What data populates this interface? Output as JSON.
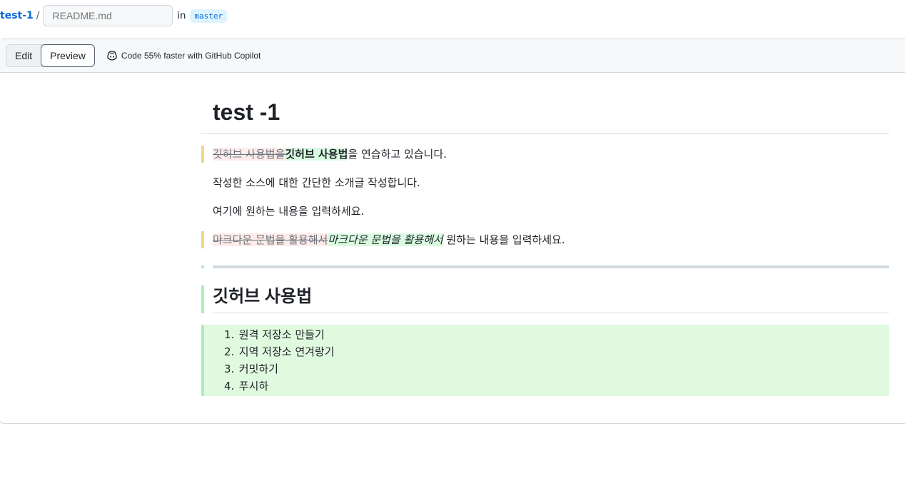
{
  "path": {
    "repo": "test-1",
    "separator": "/",
    "filename_placeholder": "README.md",
    "in_label": "in",
    "branch": "master"
  },
  "editor": {
    "tabs": {
      "edit": "Edit",
      "preview": "Preview"
    },
    "copilot_text": "Code 55% faster with GitHub Copilot"
  },
  "preview": {
    "h1": "test -1",
    "line1": {
      "deleted": "깃허브 사용법을",
      "inserted": "깃허브 사용법",
      "rest": "을 연습하고 있습니다."
    },
    "line2": "작성한 소스에 대한 간단한 소개글 작성합니다.",
    "line3": "여기에 원하는 내용을 입력하세요.",
    "line4": {
      "deleted": "마크다운 문법을 활용해서",
      "inserted": "마크다운 문법을 활용해서",
      "rest": " 원하는 내용을 입력하세요."
    },
    "h2": "깃허브 사용법",
    "list": [
      {
        "num": "1.",
        "text": "원격 저장소 만들기"
      },
      {
        "num": "2.",
        "text": "지역 저장소 연겨랑기"
      },
      {
        "num": "3.",
        "text": "커밋하기"
      },
      {
        "num": "4.",
        "text": "푸시하"
      }
    ]
  }
}
